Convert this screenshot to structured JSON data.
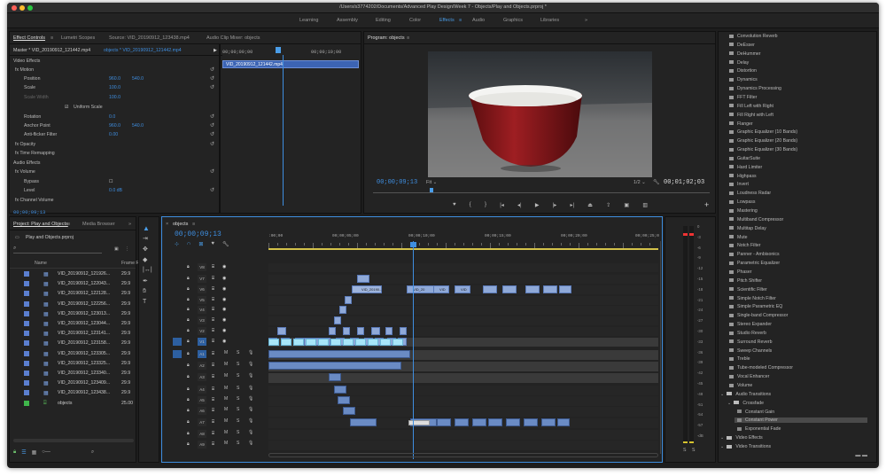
{
  "window": {
    "title": "/Users/s3774202/Documents/Advanced Play Design/Week 7 - Objects/Play and Objects.prproj *"
  },
  "workspaces": [
    {
      "label": "Learning"
    },
    {
      "label": "Assembly"
    },
    {
      "label": "Editing"
    },
    {
      "label": "Color"
    },
    {
      "label": "Effects"
    },
    {
      "label": "Audio"
    },
    {
      "label": "Graphics"
    },
    {
      "label": "Libraries"
    },
    {
      "label": "»"
    }
  ],
  "effect_controls": {
    "tabs": [
      "Effect Controls",
      "Lumetri Scopes",
      "Source: VID_20190912_123438.mp4",
      "Audio Clip Mixer: objects"
    ],
    "master": "Master * VID_20190912_121442.mp4",
    "clip_ref": "objects * VID_20190912_121442.mp4",
    "mini_times": [
      "00;00;09;00",
      "00;00;10;00"
    ],
    "mini_clip": "VID_20190912_121442.mp4",
    "rows": [
      {
        "label": "Video Effects",
        "val1": "",
        "val2": ""
      },
      {
        "label": "fx  Motion",
        "val1": "",
        "val2": ""
      },
      {
        "label": "Position",
        "val1": "960.0",
        "val2": "540.0"
      },
      {
        "label": "Scale",
        "val1": "100.0",
        "val2": ""
      },
      {
        "label": "Scale Width",
        "val1": "100.0",
        "val2": ""
      },
      {
        "label": "Uniform Scale",
        "val1": "",
        "val2": ""
      },
      {
        "label": "Rotation",
        "val1": "0.0",
        "val2": ""
      },
      {
        "label": "Anchor Point",
        "val1": "960.0",
        "val2": "540.0"
      },
      {
        "label": "Anti-flicker Filter",
        "val1": "0.00",
        "val2": ""
      },
      {
        "label": "fx  Opacity",
        "val1": "",
        "val2": ""
      },
      {
        "label": "fx  Time Remapping",
        "val1": "",
        "val2": ""
      },
      {
        "label": "Audio Effects",
        "val1": "",
        "val2": ""
      },
      {
        "label": "fx  Volume",
        "val1": "",
        "val2": ""
      },
      {
        "label": "Bypass",
        "val1": "",
        "val2": ""
      },
      {
        "label": "Level",
        "val1": "0.0 dB",
        "val2": ""
      },
      {
        "label": "fx  Channel Volume",
        "val1": "",
        "val2": ""
      }
    ],
    "timecode": "00;00;09;13"
  },
  "program": {
    "title": "Program: objects",
    "timecode": "00;00;09;13",
    "fit": "Fit",
    "ratio": "1/2",
    "duration": "00;01;02;03"
  },
  "project": {
    "tabs": [
      "Project: Play and Objects",
      "Media Browser"
    ],
    "file": "Play and Objects.prproj",
    "col_name": "Name",
    "col_rate": "Frame R",
    "items": [
      {
        "name": "VID_20190912_121926...",
        "rate": "29.9",
        "color": "#5b7fd0"
      },
      {
        "name": "VID_20190912_122043...",
        "rate": "29.9",
        "color": "#5b7fd0"
      },
      {
        "name": "VID_20190912_122128...",
        "rate": "29.9",
        "color": "#5b7fd0"
      },
      {
        "name": "VID_20190912_122256...",
        "rate": "29.9",
        "color": "#5b7fd0"
      },
      {
        "name": "VID_20190912_123013...",
        "rate": "29.9",
        "color": "#5b7fd0"
      },
      {
        "name": "VID_20190912_123044...",
        "rate": "29.9",
        "color": "#5b7fd0"
      },
      {
        "name": "VID_20190912_123141...",
        "rate": "29.9",
        "color": "#5b7fd0"
      },
      {
        "name": "VID_20190912_123158...",
        "rate": "29.9",
        "color": "#5b7fd0"
      },
      {
        "name": "VID_20190912_123305...",
        "rate": "29.9",
        "color": "#5b7fd0"
      },
      {
        "name": "VID_20190912_123325...",
        "rate": "29.9",
        "color": "#5b7fd0"
      },
      {
        "name": "VID_20190912_123340...",
        "rate": "29.9",
        "color": "#5b7fd0"
      },
      {
        "name": "VID_20190912_123409...",
        "rate": "29.9",
        "color": "#5b7fd0"
      },
      {
        "name": "VID_20190912_123438...",
        "rate": "29.9",
        "color": "#5b7fd0"
      },
      {
        "name": "objects",
        "rate": "25.00",
        "color": "#3fb64b"
      }
    ]
  },
  "timeline": {
    "tab": "objects",
    "timecode": "00;00;09;13",
    "ruler": [
      ":00;00",
      "00;00;05;00",
      "00;00;10;00",
      "00;00;15;00",
      "00;00;20;00",
      "00;00;25;0"
    ],
    "video_tracks": [
      "V8",
      "V7",
      "V6",
      "V5",
      "V4",
      "V3",
      "V2",
      "V1"
    ],
    "audio_tracks": [
      "A1",
      "A2",
      "A3",
      "A4",
      "A5",
      "A6",
      "A7",
      "A8",
      "A9"
    ],
    "v6_clip": "VID_20190...",
    "v6_labels": [
      "VID_20",
      "VID",
      "VID"
    ]
  },
  "meter": {
    "scale": [
      "0",
      "-3",
      "-6",
      "-9",
      "-12",
      "-15",
      "-18",
      "-21",
      "-24",
      "-27",
      "-30",
      "-33",
      "-36",
      "-39",
      "-42",
      "-45",
      "-48",
      "-51",
      "-54",
      "-57",
      "-dB"
    ],
    "bottom": [
      "S",
      "S"
    ]
  },
  "effects_list": {
    "audio_fx": [
      "Convolution Reverb",
      "DeEsser",
      "DeHummer",
      "Delay",
      "Distortion",
      "Dynamics",
      "Dynamics Processing",
      "FFT Filter",
      "Fill Left with Right",
      "Fill Right with Left",
      "Flanger",
      "Graphic Equalizer (10 Bands)",
      "Graphic Equalizer (20 Bands)",
      "Graphic Equalizer (30 Bands)",
      "GuitarSuite",
      "Hard Limiter",
      "Highpass",
      "Invert",
      "Loudness Radar",
      "Lowpass",
      "Mastering",
      "Multiband Compressor",
      "Multitap Delay",
      "Mute",
      "Notch Filter",
      "Panner - Ambisonics",
      "Parametric Equalizer",
      "Phaser",
      "Pitch Shifter",
      "Scientific Filter",
      "Simple Notch Filter",
      "Simple Parametric EQ",
      "Single-band Compressor",
      "Stereo Expander",
      "Studio Reverb",
      "Surround Reverb",
      "Sweep Channels",
      "Treble",
      "Tube-modeled Compressor",
      "Vocal Enhancer",
      "Volume"
    ],
    "audio_transitions": "Audio Transitions",
    "crossfade": "Crossfade",
    "crossfade_items": [
      "Constant Gain",
      "Constant Power",
      "Exponential Fade"
    ],
    "video_effects": "Video Effects",
    "video_transitions": "Video Transitions"
  }
}
